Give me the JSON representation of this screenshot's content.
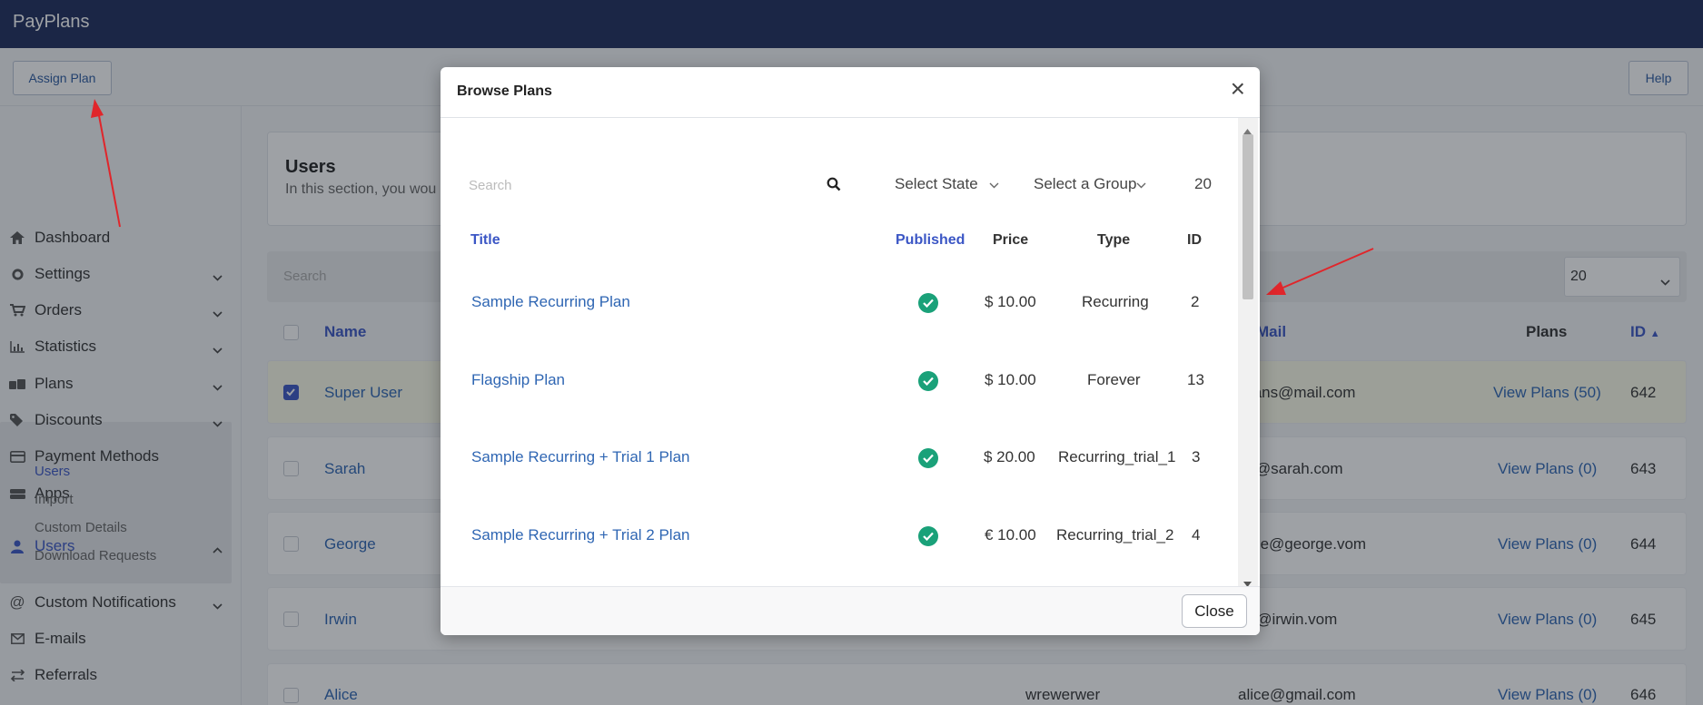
{
  "app": {
    "title": "PayPlans"
  },
  "toolbar": {
    "assign_plan": "Assign Plan",
    "help": "Help"
  },
  "sidebar": {
    "items": [
      {
        "label": "Dashboard",
        "icon": "home-icon"
      },
      {
        "label": "Settings",
        "icon": "gear-icon"
      },
      {
        "label": "Orders",
        "icon": "cart-icon"
      },
      {
        "label": "Statistics",
        "icon": "chart-icon"
      },
      {
        "label": "Plans",
        "icon": "boxes-icon"
      },
      {
        "label": "Discounts",
        "icon": "tag-icon"
      },
      {
        "label": "Payment Methods",
        "icon": "credit-card-icon"
      },
      {
        "label": "Apps",
        "icon": "server-icon"
      },
      {
        "label": "Users",
        "icon": "user-icon"
      },
      {
        "label": "Custom Notifications",
        "icon": "at-icon"
      },
      {
        "label": "E-mails",
        "icon": "envelope-icon"
      },
      {
        "label": "Referrals",
        "icon": "exchange-icon"
      }
    ],
    "users_sub": [
      "Users",
      "Import",
      "Custom Details",
      "Download Requests"
    ]
  },
  "page": {
    "title": "Users",
    "description": "In this section, you wou",
    "search_placeholder": "Search",
    "page_size": "20"
  },
  "table": {
    "headers": {
      "name": "Name",
      "email": "Mail",
      "plans": "Plans",
      "id": "ID"
    },
    "rows": [
      {
        "name": "Super User",
        "username": "",
        "email": "yplans@mail.com",
        "plans": "View Plans (50)",
        "id": "642",
        "checked": true
      },
      {
        "name": "Sarah",
        "username": "",
        "email": "ah@sarah.com",
        "plans": "View Plans (0)",
        "id": "643",
        "checked": false
      },
      {
        "name": "George",
        "username": "",
        "email": "orge@george.vom",
        "plans": "View Plans (0)",
        "id": "644",
        "checked": false
      },
      {
        "name": "Irwin",
        "username": "",
        "email": "in@irwin.vom",
        "plans": "View Plans (0)",
        "id": "645",
        "checked": false
      },
      {
        "name": "Alice",
        "username": "wrewerwer",
        "email": "alice@gmail.com",
        "plans": "View Plans (0)",
        "id": "646",
        "checked": false
      }
    ]
  },
  "modal": {
    "title": "Browse Plans",
    "close_x": "×",
    "search_placeholder": "Search",
    "state_select": "Select State",
    "group_select": "Select a Group",
    "limit": "20",
    "headers": {
      "title": "Title",
      "published": "Published",
      "price": "Price",
      "type": "Type",
      "id": "ID"
    },
    "plans": [
      {
        "title": "Sample Recurring Plan",
        "price": "$ 10.00",
        "type": "Recurring",
        "id": "2"
      },
      {
        "title": "Flagship Plan",
        "price": "$ 10.00",
        "type": "Forever",
        "id": "13"
      },
      {
        "title": "Sample Recurring + Trial 1 Plan",
        "price": "$ 20.00",
        "type": "Recurring_trial_1",
        "id": "3"
      },
      {
        "title": "Sample Recurring + Trial 2 Plan",
        "price": "€ 10.00",
        "type": "Recurring_trial_2",
        "id": "4"
      }
    ],
    "close_button": "Close"
  },
  "colors": {
    "topbar": "#1e2b5c",
    "link": "#2f66b3",
    "header_link": "#3b56c5",
    "published": "#1aa179",
    "arrow": "#e0262b"
  }
}
